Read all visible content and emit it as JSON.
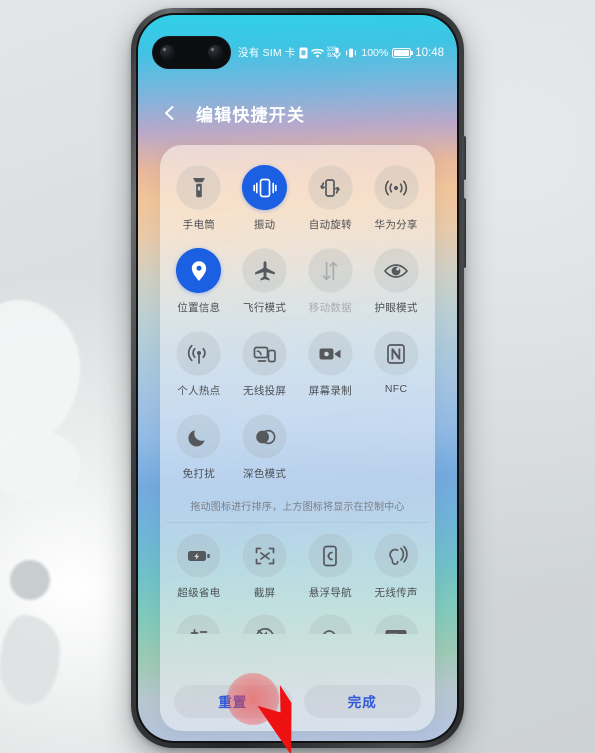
{
  "device": {
    "frame": "huawei-phone",
    "accent_blue": "#1b5fe2",
    "tap_color": "#f44040"
  },
  "statusbar": {
    "sim_text": "没有 SIM 卡",
    "sim_card_icon": "sim-card-icon",
    "wifi_icon": "wifi-icon",
    "net_rate_value": "328",
    "net_rate_unit": "B/s",
    "mic_icon": "microphone-icon",
    "vibrate_icon": "vibrate-icon",
    "battery_percent": "100%",
    "battery_icon": "battery-full-icon",
    "clock": "10:48"
  },
  "header": {
    "back_icon": "back-arrow-icon",
    "title": "编辑快捷开关"
  },
  "panel": {
    "hint": "拖动图标进行排序，上方图标将显示在控制中心",
    "active_tiles": [
      "振动",
      "位置信息"
    ],
    "disabled_tiles": [
      "移动数据"
    ],
    "enabled_section": [
      {
        "label": "手电筒",
        "icon": "flashlight-icon",
        "state": "off"
      },
      {
        "label": "振动",
        "icon": "vibrate-icon",
        "state": "on"
      },
      {
        "label": "自动旋转",
        "icon": "auto-rotate-icon",
        "state": "off"
      },
      {
        "label": "华为分享",
        "icon": "huawei-share-icon",
        "state": "off"
      },
      {
        "label": "位置信息",
        "icon": "location-pin-icon",
        "state": "on"
      },
      {
        "label": "飞行模式",
        "icon": "airplane-icon",
        "state": "off"
      },
      {
        "label": "移动数据",
        "icon": "mobile-data-icon",
        "state": "disabled"
      },
      {
        "label": "护眼模式",
        "icon": "eye-comfort-icon",
        "state": "off"
      },
      {
        "label": "个人热点",
        "icon": "hotspot-icon",
        "state": "off"
      },
      {
        "label": "无线投屏",
        "icon": "wireless-projection-icon",
        "state": "off"
      },
      {
        "label": "屏幕录制",
        "icon": "screen-record-icon",
        "state": "off"
      },
      {
        "label": "NFC",
        "icon": "nfc-icon",
        "state": "off"
      },
      {
        "label": "免打扰",
        "icon": "do-not-disturb-moon-icon",
        "state": "off"
      },
      {
        "label": "深色模式",
        "icon": "dark-mode-icon",
        "state": "off"
      }
    ],
    "available_section": [
      {
        "label": "超级省电",
        "icon": "super-power-saving-icon"
      },
      {
        "label": "截屏",
        "icon": "screenshot-icon"
      },
      {
        "label": "悬浮导航",
        "icon": "floating-navigation-icon"
      },
      {
        "label": "无线传声",
        "icon": "wireless-audio-icon"
      }
    ],
    "clipped_section": [
      {
        "icon": "calculator-icon"
      },
      {
        "icon": "mute-icon"
      },
      {
        "icon": "weather-cloud-icon"
      },
      {
        "icon": "wallet-card-icon"
      }
    ]
  },
  "footer": {
    "reset_label": "重置",
    "done_label": "完成"
  },
  "cursor": {
    "type": "red-arrow-pointer",
    "target": "重置"
  }
}
